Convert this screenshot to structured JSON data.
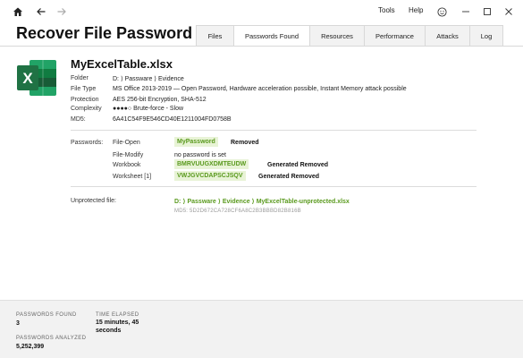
{
  "titlebar": {
    "menu_tools": "Tools",
    "menu_help": "Help"
  },
  "app": {
    "title": "Recover File Password"
  },
  "tabs": [
    {
      "label": "Files",
      "active": false
    },
    {
      "label": "Passwords Found",
      "active": true
    },
    {
      "label": "Resources",
      "active": false
    },
    {
      "label": "Performance",
      "active": false
    },
    {
      "label": "Attacks",
      "active": false
    },
    {
      "label": "Log",
      "active": false
    }
  ],
  "file": {
    "name": "MyExcelTable.xlsx",
    "icon_letter": "X",
    "icon": "excel-icon",
    "details": [
      {
        "label": "Folder",
        "value": "D: ⟩ Passware ⟩ Evidence"
      },
      {
        "label": "File Type",
        "value": "MS Office 2013-2019 — Open Password, Hardware acceleration possible, Instant Memory attack possible"
      },
      {
        "label": "Protection",
        "value": "AES 256-bit Encryption, SHA-512"
      },
      {
        "label": "Complexity",
        "value": "●●●●○ Brute-force - Slow"
      },
      {
        "label": "MD5:",
        "value": "6A41C54F9E546CD40E1211004FD0758B"
      }
    ]
  },
  "passwords": {
    "section_label": "Passwords:",
    "rows": [
      {
        "type": "File-Open",
        "password": "MyPassword",
        "status": "Removed"
      },
      {
        "type": "File-Modify",
        "password": "",
        "plain": "no password is set",
        "status": ""
      },
      {
        "type": "Workbook",
        "password": "BMRVUUGXDMTEUDW",
        "status": "Generated Removed"
      },
      {
        "type": "Worksheet [1]",
        "password": "VWJGVCDAPSCJSQV",
        "status": "Generated Removed"
      }
    ]
  },
  "unprotected": {
    "label": "Unprotected file:",
    "path": "D: ⟩ Passware ⟩ Evidence ⟩ MyExcelTable-unprotected.xlsx",
    "md5": "MD5: 5D2D672CA728CF6A8C2B3BBBD82B816B"
  },
  "footer": {
    "passwords_found_label": "PASSWORDS FOUND",
    "passwords_found_value": "3",
    "time_elapsed_label": "TIME ELAPSED",
    "time_elapsed_value_1": "15 minutes, 45",
    "time_elapsed_value_2": "seconds",
    "passwords_analyzed_label": "PASSWORDS ANALYZED",
    "passwords_analyzed_value": "5,252,399"
  },
  "colors": {
    "accent_green": "#5a9a1e",
    "chip_bg": "#e8f3d6",
    "excel_green": "#1f7244"
  }
}
